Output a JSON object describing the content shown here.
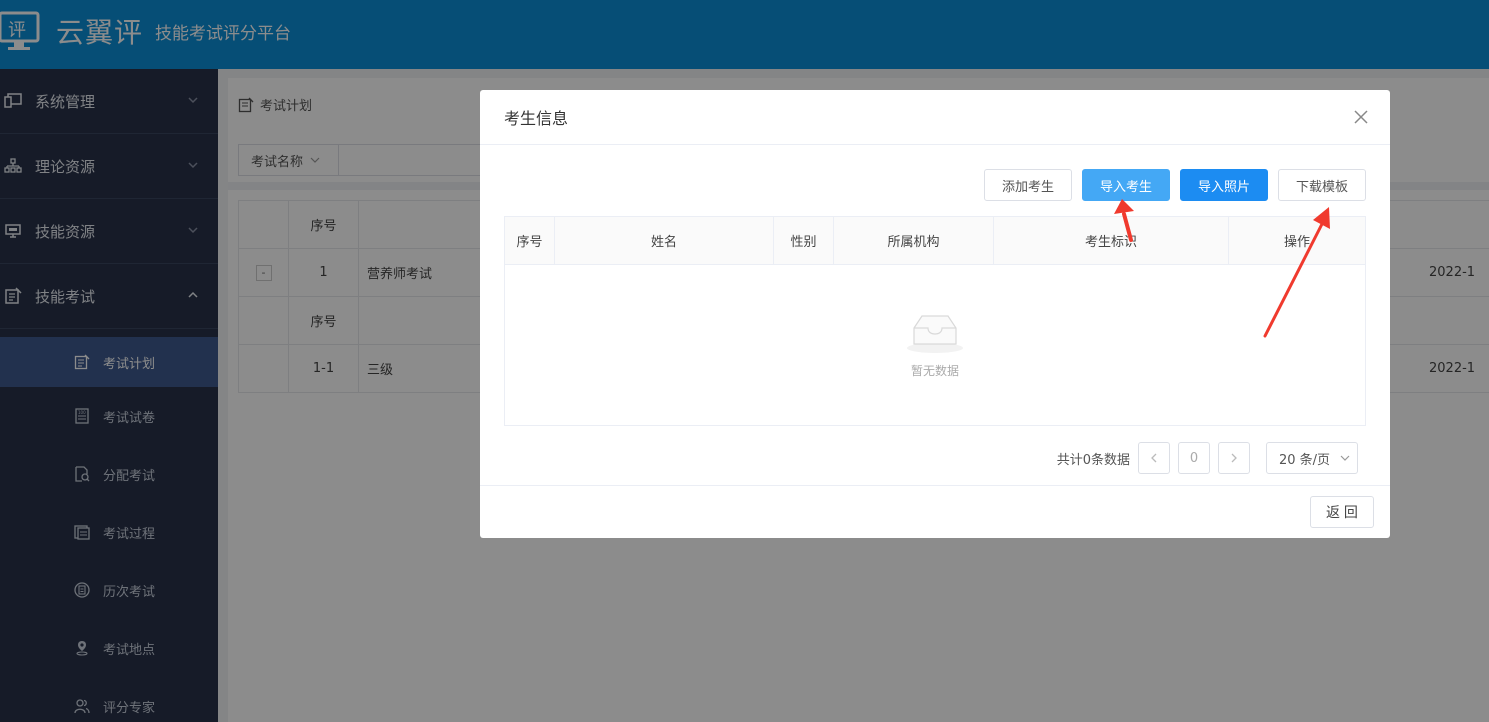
{
  "header": {
    "app_name": "云翼评",
    "slogan": "技能考试评分平台",
    "logo_glyph": "评",
    "bg_color": "#0b8ed8"
  },
  "sidebar": {
    "groups": [
      {
        "label": "系统管理",
        "icon": "monitor-icon",
        "expanded": false
      },
      {
        "label": "理论资源",
        "icon": "org-chart-icon",
        "expanded": false
      },
      {
        "label": "技能资源",
        "icon": "desktop-icon",
        "expanded": false
      },
      {
        "label": "技能考试",
        "icon": "edit-icon",
        "expanded": true
      }
    ],
    "sub_items": [
      {
        "label": "考试计划",
        "icon": "edit-doc-icon",
        "active": true
      },
      {
        "label": "考试试卷",
        "icon": "score-paper-icon",
        "active": false
      },
      {
        "label": "分配考试",
        "icon": "doc-search-icon",
        "active": false
      },
      {
        "label": "考试过程",
        "icon": "list-doc-icon",
        "active": false
      },
      {
        "label": "历次考试",
        "icon": "history-icon",
        "active": false
      },
      {
        "label": "考试地点",
        "icon": "location-icon",
        "active": false
      },
      {
        "label": "评分专家",
        "icon": "users-icon",
        "active": false
      }
    ]
  },
  "main": {
    "breadcrumb": "考试计划",
    "filter_label": "考试名称",
    "table": {
      "header_seq": "序号",
      "rows": [
        {
          "seq": "1",
          "name": "营养师考试",
          "date": "2022-1",
          "expand": "-"
        },
        {
          "seq": "1-1",
          "name": "三级",
          "date": "2022-1"
        }
      ],
      "sub_header_seq": "序号"
    }
  },
  "dialog": {
    "title": "考生信息",
    "buttons": {
      "add": "添加考生",
      "import_students": "导入考生",
      "import_photos": "导入照片",
      "download_template": "下载模板"
    },
    "columns": [
      "序号",
      "姓名",
      "性别",
      "所属机构",
      "考生标识",
      "操作"
    ],
    "empty_text": "暂无数据",
    "pager": {
      "total": "共计0条数据",
      "current_page": "0",
      "page_size": "20 条/页"
    },
    "back_label": "返 回"
  },
  "annotation_color": "#f03a2e"
}
